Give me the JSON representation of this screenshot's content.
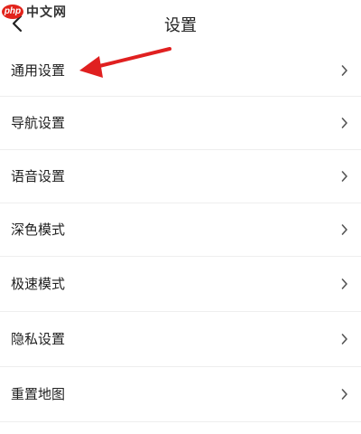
{
  "watermark": {
    "badge": "php",
    "text": "中文网"
  },
  "header": {
    "title": "设置",
    "back_icon": "chevron-left-icon"
  },
  "settings": {
    "items": [
      {
        "label": "通用设置"
      },
      {
        "label": "导航设置"
      },
      {
        "label": "语音设置"
      },
      {
        "label": "深色模式"
      },
      {
        "label": "极速模式"
      },
      {
        "label": "隐私设置"
      },
      {
        "label": "重置地图"
      }
    ]
  },
  "annotation": {
    "color": "#e02020",
    "target": "通用设置"
  }
}
